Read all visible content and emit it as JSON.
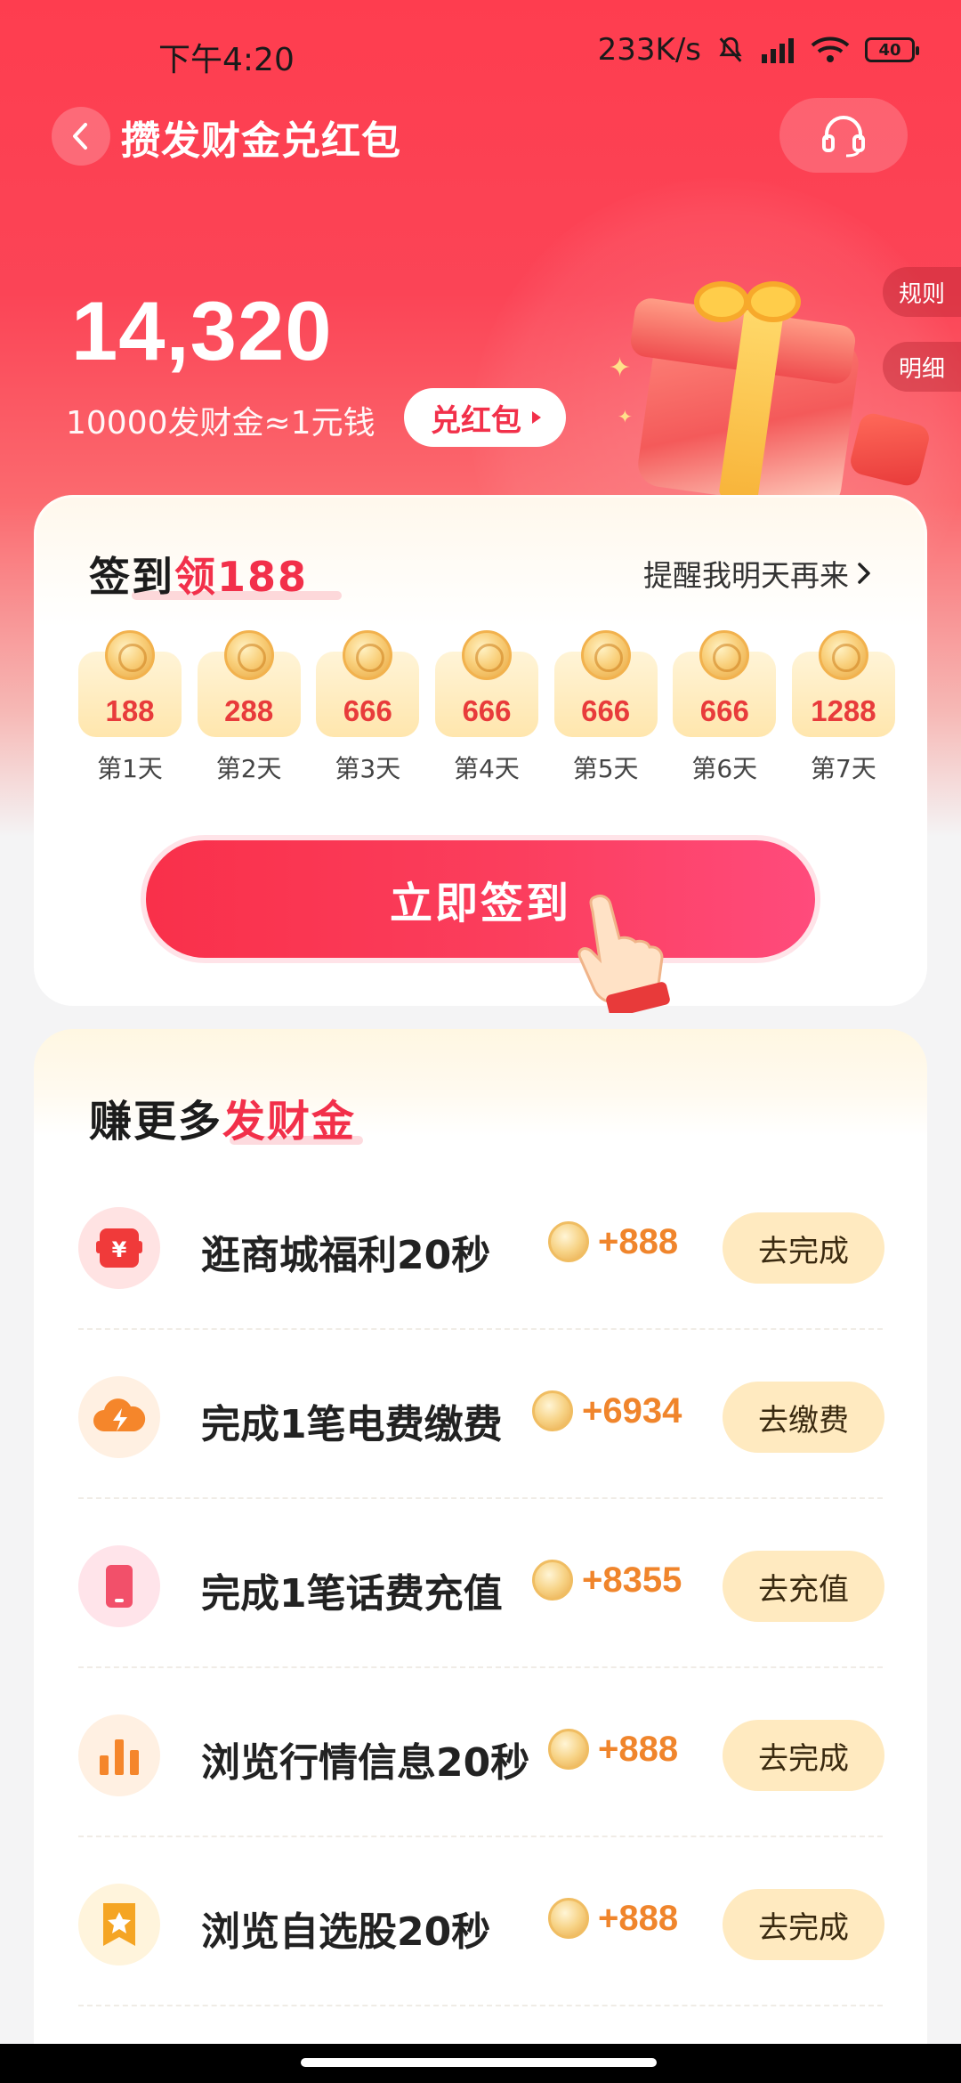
{
  "status_bar": {
    "time": "下午4:20",
    "network_speed": "233K/s",
    "battery": "40"
  },
  "header": {
    "title": "攒发财金兑红包",
    "back_icon": "chevron-left-icon",
    "service_icon": "headset-icon"
  },
  "side_tabs": {
    "rules": "规则",
    "details": "明细"
  },
  "balance": {
    "amount": "14,320",
    "rate_text": "10000发财金≈1元钱",
    "redeem_label": "兑红包"
  },
  "checkin": {
    "title_prefix": "签到",
    "title_highlight": "领188",
    "reminder": "提醒我明天再来",
    "days": [
      {
        "value": "188",
        "label": "第1天"
      },
      {
        "value": "288",
        "label": "第2天"
      },
      {
        "value": "666",
        "label": "第3天"
      },
      {
        "value": "666",
        "label": "第4天"
      },
      {
        "value": "666",
        "label": "第5天"
      },
      {
        "value": "666",
        "label": "第6天"
      },
      {
        "value": "1288",
        "label": "第7天"
      }
    ],
    "button_label": "立即签到"
  },
  "tasks": {
    "title_prefix": "赚更多",
    "title_highlight": "发财金",
    "items": [
      {
        "label": "逛商城福利20秒",
        "reward": "+888",
        "action": "去完成",
        "icon": "mall-icon",
        "color": "#f03a3a"
      },
      {
        "label": "完成1笔电费缴费",
        "reward": "+6934",
        "action": "去缴费",
        "icon": "lightning-cloud-icon",
        "color": "#f5862b"
      },
      {
        "label": "完成1笔话费充值",
        "reward": "+8355",
        "action": "去充值",
        "icon": "phone-icon",
        "color": "#f2506a"
      },
      {
        "label": "浏览行情信息20秒",
        "reward": "+888",
        "action": "去完成",
        "icon": "bar-chart-icon",
        "color": "#f5862b"
      },
      {
        "label": "浏览自选股20秒",
        "reward": "+888",
        "action": "去完成",
        "icon": "star-icon",
        "color": "#f5a524"
      }
    ]
  }
}
